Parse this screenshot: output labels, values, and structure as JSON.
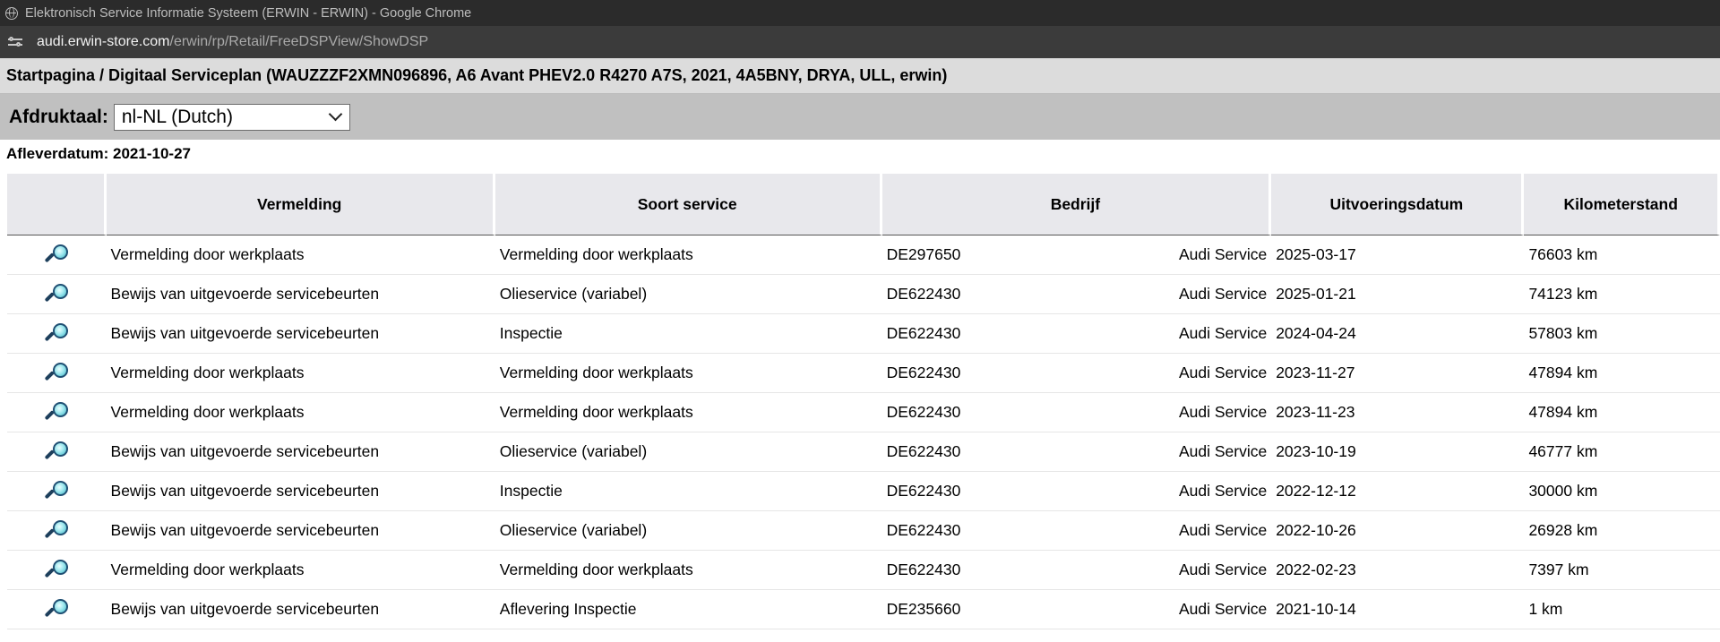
{
  "window": {
    "title": "Elektronisch Service Informatie Systeem (ERWIN - ERWIN) - Google Chrome"
  },
  "address_bar": {
    "host": "audi.erwin-store.com",
    "path": "/erwin/rp/Retail/FreeDSPView/ShowDSP"
  },
  "page": {
    "breadcrumb": "Startpagina / Digitaal Serviceplan (WAUZZZF2XMN096896, A6 Avant PHEV2.0 R4270 A7S, 2021, 4A5BNY, DRYA, ULL, erwin)",
    "print_language_label": "Afdruktaal:",
    "print_language_value": "nl-NL (Dutch)",
    "delivery_date": "Afleverdatum: 2021-10-27"
  },
  "table": {
    "headers": [
      "",
      "Vermelding",
      "Soort service",
      "Bedrijf",
      "Uitvoeringsdatum",
      "Kilometerstand"
    ],
    "rows": [
      {
        "vermelding": "Vermelding door werkplaats",
        "soort": "Vermelding door werkplaats",
        "bedrijf_code": "DE297650",
        "bedrijf_name": "Audi Service",
        "datum": "2025-03-17",
        "km": "76603 km"
      },
      {
        "vermelding": "Bewijs van uitgevoerde servicebeurten",
        "soort": "Olieservice (variabel)",
        "bedrijf_code": "DE622430",
        "bedrijf_name": "Audi Service",
        "datum": "2025-01-21",
        "km": "74123 km"
      },
      {
        "vermelding": "Bewijs van uitgevoerde servicebeurten",
        "soort": "Inspectie",
        "bedrijf_code": "DE622430",
        "bedrijf_name": "Audi Service",
        "datum": "2024-04-24",
        "km": "57803 km"
      },
      {
        "vermelding": "Vermelding door werkplaats",
        "soort": "Vermelding door werkplaats",
        "bedrijf_code": "DE622430",
        "bedrijf_name": "Audi Service",
        "datum": "2023-11-27",
        "km": "47894 km"
      },
      {
        "vermelding": "Vermelding door werkplaats",
        "soort": "Vermelding door werkplaats",
        "bedrijf_code": "DE622430",
        "bedrijf_name": "Audi Service",
        "datum": "2023-11-23",
        "km": "47894 km"
      },
      {
        "vermelding": "Bewijs van uitgevoerde servicebeurten",
        "soort": "Olieservice (variabel)",
        "bedrijf_code": "DE622430",
        "bedrijf_name": "Audi Service",
        "datum": "2023-10-19",
        "km": "46777 km"
      },
      {
        "vermelding": "Bewijs van uitgevoerde servicebeurten",
        "soort": "Inspectie",
        "bedrijf_code": "DE622430",
        "bedrijf_name": "Audi Service",
        "datum": "2022-12-12",
        "km": "30000 km"
      },
      {
        "vermelding": "Bewijs van uitgevoerde servicebeurten",
        "soort": "Olieservice (variabel)",
        "bedrijf_code": "DE622430",
        "bedrijf_name": "Audi Service",
        "datum": "2022-10-26",
        "km": "26928 km"
      },
      {
        "vermelding": "Vermelding door werkplaats",
        "soort": "Vermelding door werkplaats",
        "bedrijf_code": "DE622430",
        "bedrijf_name": "Audi Service",
        "datum": "2022-02-23",
        "km": "7397 km"
      },
      {
        "vermelding": "Bewijs van uitgevoerde servicebeurten",
        "soort": "Aflevering Inspectie",
        "bedrijf_code": "DE235660",
        "bedrijf_name": "Audi Service",
        "datum": "2021-10-14",
        "km": "1 km"
      }
    ]
  },
  "icons": {
    "row_icon": "magnifier-icon"
  }
}
